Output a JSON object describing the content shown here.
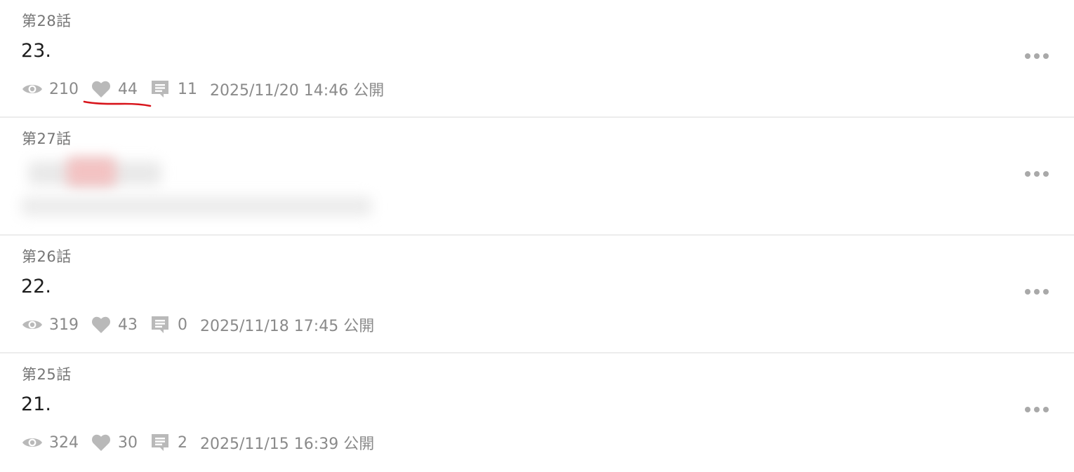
{
  "episodes": [
    {
      "number": "第28話",
      "title": "23.",
      "views": "210",
      "likes": "44",
      "comments": "11",
      "published": "2025/11/20 14:46 公開",
      "likes_annotated": true
    },
    {
      "number": "第27話",
      "title": "",
      "views": "",
      "likes": "",
      "comments": "",
      "published": "",
      "redacted": true
    },
    {
      "number": "第26話",
      "title": "22.",
      "views": "319",
      "likes": "43",
      "comments": "0",
      "published": "2025/11/18 17:45 公開"
    },
    {
      "number": "第25話",
      "title": "21.",
      "views": "324",
      "likes": "30",
      "comments": "2",
      "published": "2025/11/15 16:39 公開"
    }
  ],
  "icons": {
    "views": "eye-icon",
    "likes": "heart-icon",
    "comments": "comment-icon",
    "more": "more-horizontal-icon"
  },
  "colors": {
    "icon": "#b9b9b9",
    "annotation": "#d8141b",
    "divider": "#ececec"
  }
}
